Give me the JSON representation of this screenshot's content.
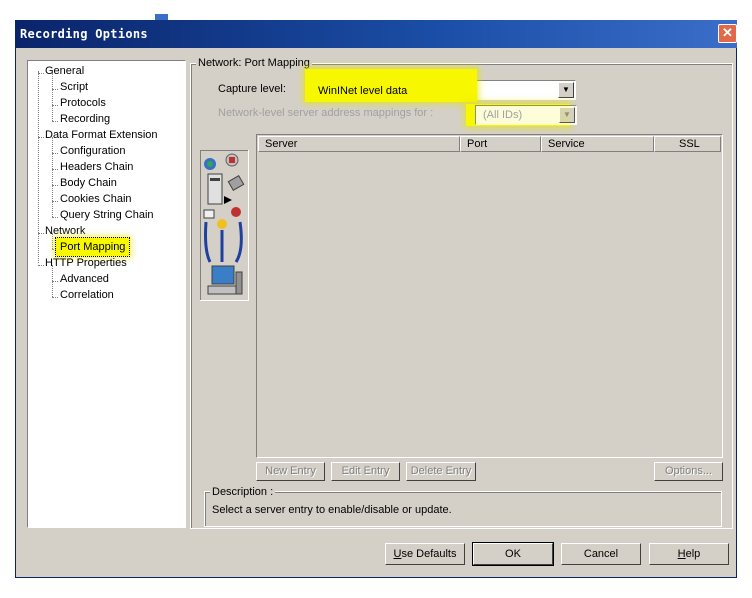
{
  "window": {
    "title": "Recording Options",
    "close_glyph": "✕"
  },
  "tree": {
    "items": [
      {
        "label": "General",
        "level": 0
      },
      {
        "label": "Script",
        "level": 1
      },
      {
        "label": "Protocols",
        "level": 1
      },
      {
        "label": "Recording",
        "level": 1
      },
      {
        "label": "Data Format Extension",
        "level": 0
      },
      {
        "label": "Configuration",
        "level": 1
      },
      {
        "label": "Headers Chain",
        "level": 1
      },
      {
        "label": "Body Chain",
        "level": 1
      },
      {
        "label": "Cookies Chain",
        "level": 1
      },
      {
        "label": "Query String Chain",
        "level": 1
      },
      {
        "label": "Network",
        "level": 0
      },
      {
        "label": "Port Mapping",
        "level": 1,
        "selected": true
      },
      {
        "label": "HTTP Properties",
        "level": 0
      },
      {
        "label": "Advanced",
        "level": 1
      },
      {
        "label": "Correlation",
        "level": 1
      }
    ]
  },
  "panel": {
    "group_title": "Network: Port Mapping",
    "capture_level_label": "Capture level:",
    "capture_level_value": "WinINet level data",
    "mapping_label": "Network-level server address mappings for :",
    "mapping_value": "(All IDs)",
    "columns": [
      "Server",
      "Port",
      "Service",
      "SSL"
    ],
    "buttons": {
      "new_entry": "New Entry",
      "edit_entry": "Edit Entry",
      "delete_entry": "Delete Entry",
      "options": "Options..."
    },
    "description_label": "Description :",
    "description_text": "Select a server entry to enable/disable or update."
  },
  "footer": {
    "use_defaults": "Use Defaults",
    "ok": "OK",
    "cancel": "Cancel",
    "help": "Help"
  },
  "colors": {
    "highlight": "#f7f700",
    "title_bar": "#0a246a",
    "dialog_bg": "#d4d0c8"
  }
}
